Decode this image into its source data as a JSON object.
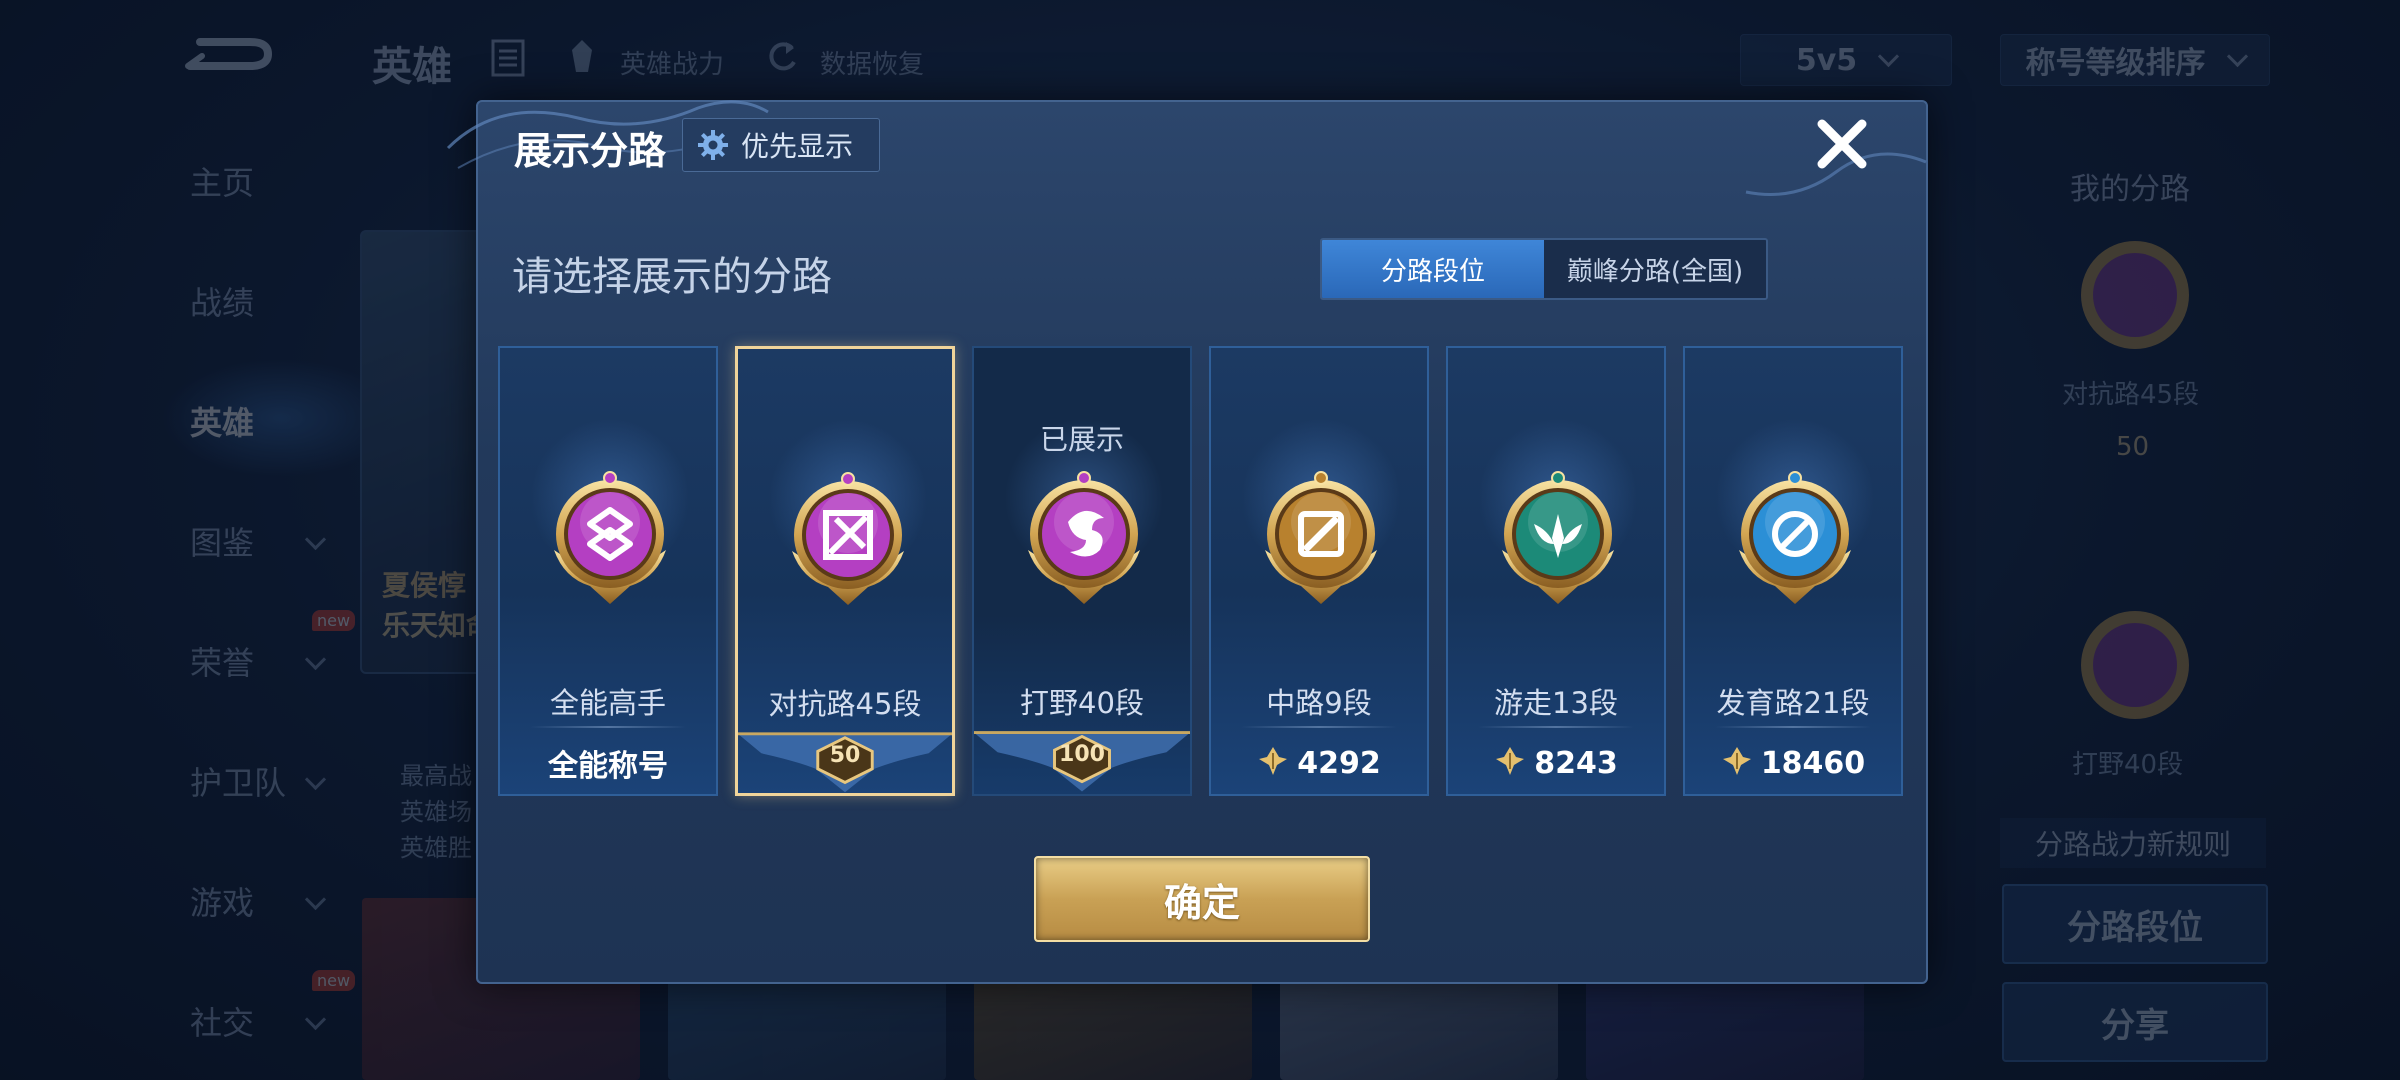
{
  "background": {
    "header": {
      "title": "英雄",
      "link_power": "英雄战力",
      "link_restore": "数据恢复",
      "mode_select": "5v5",
      "sort_select": "称号等级排序"
    },
    "sidebar": {
      "items": [
        {
          "label": "主页",
          "has_chevron": false,
          "is_new": false,
          "active": false
        },
        {
          "label": "战绩",
          "has_chevron": false,
          "is_new": false,
          "active": false
        },
        {
          "label": "英雄",
          "has_chevron": false,
          "is_new": false,
          "active": true
        },
        {
          "label": "图鉴",
          "has_chevron": true,
          "is_new": false,
          "active": false
        },
        {
          "label": "荣誉",
          "has_chevron": true,
          "is_new": true,
          "active": false
        },
        {
          "label": "护卫队",
          "has_chevron": true,
          "is_new": false,
          "active": false
        },
        {
          "label": "游戏",
          "has_chevron": true,
          "is_new": false,
          "active": false
        },
        {
          "label": "社交",
          "has_chevron": true,
          "is_new": true,
          "active": false
        }
      ],
      "new_badge": "new"
    },
    "hero_card": {
      "name_partial": "夏侯惇",
      "subtitle_partial": "乐天知命",
      "desc_lines": [
        "最高战",
        "英雄场",
        "英雄胜"
      ]
    },
    "right_panel": {
      "title": "我的分路",
      "lane1_label": "对抗路45段",
      "lane1_rank": "50",
      "lane2_label": "打野40段",
      "rule_text": "分路战力新规则",
      "btn_lane_rank": "分路段位",
      "btn_share": "分享"
    }
  },
  "modal": {
    "title": "展示分路",
    "priority_button": "优先显示",
    "subtitle": "请选择展示的分路",
    "tabs": [
      {
        "label": "分路段位",
        "active": true
      },
      {
        "label": "巅峰分路(全国)",
        "active": false
      }
    ],
    "shown_label": "已展示",
    "cards": [
      {
        "name": "全能高手",
        "bottom_type": "label",
        "bottom": "全能称号",
        "badge": "allround",
        "color": "#b43fc2",
        "selected": false,
        "shown": false
      },
      {
        "name": "对抗路45段",
        "bottom_type": "rank",
        "bottom": "50",
        "badge": "clash-lane",
        "color": "#b43fc2",
        "selected": true,
        "shown": false
      },
      {
        "name": "打野40段",
        "bottom_type": "rank",
        "bottom": "100",
        "badge": "jungle",
        "color": "#b43fc2",
        "selected": false,
        "shown": true
      },
      {
        "name": "中路9段",
        "bottom_type": "power",
        "bottom": "4292",
        "badge": "mid-lane",
        "color": "#b8812e",
        "selected": false,
        "shown": false
      },
      {
        "name": "游走13段",
        "bottom_type": "power",
        "bottom": "8243",
        "badge": "roam",
        "color": "#1c8a78",
        "selected": false,
        "shown": false
      },
      {
        "name": "发育路21段",
        "bottom_type": "power",
        "bottom": "18460",
        "badge": "farm-lane",
        "color": "#2b8fd6",
        "selected": false,
        "shown": false
      }
    ],
    "confirm_button": "确定"
  }
}
